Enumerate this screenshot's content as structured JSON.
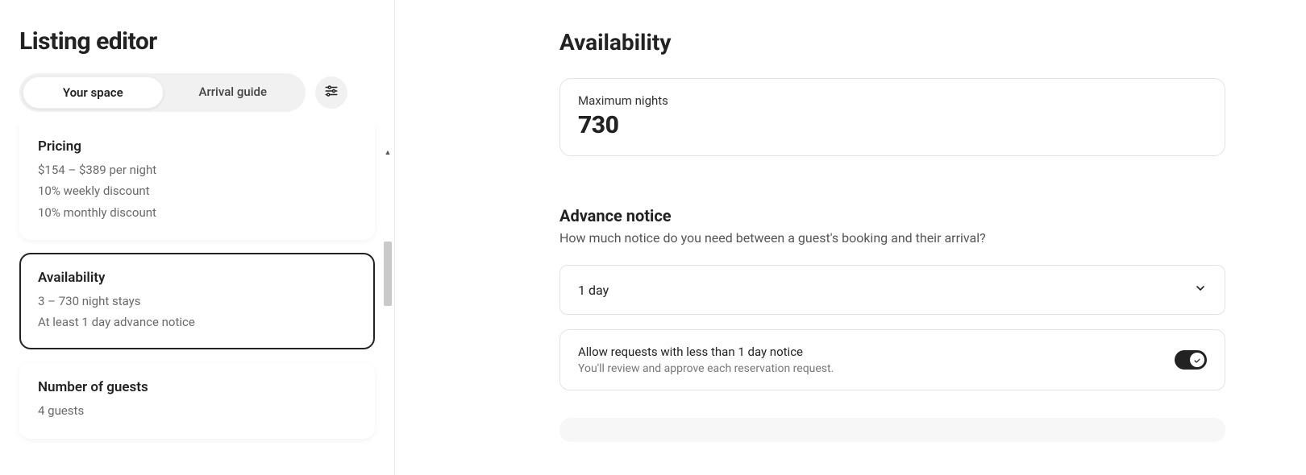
{
  "pageTitle": "Listing editor",
  "tabs": {
    "yourSpace": "Your space",
    "arrivalGuide": "Arrival guide"
  },
  "cards": {
    "pricing": {
      "title": "Pricing",
      "line1": "$154 – $389 per night",
      "line2": "10% weekly discount",
      "line3": "10% monthly discount"
    },
    "availability": {
      "title": "Availability",
      "line1": "3 – 730 night stays",
      "line2": "At least 1 day advance notice"
    },
    "guests": {
      "title": "Number of guests",
      "line1": "4 guests"
    }
  },
  "main": {
    "title": "Availability",
    "maxNights": {
      "label": "Maximum nights",
      "value": "730"
    },
    "advanceNotice": {
      "title": "Advance notice",
      "sub": "How much notice do you need between a guest's booking and their arrival?",
      "selected": "1 day"
    },
    "allowRequests": {
      "label": "Allow requests with less than 1 day notice",
      "sub": "You'll review and approve each reservation request."
    }
  }
}
